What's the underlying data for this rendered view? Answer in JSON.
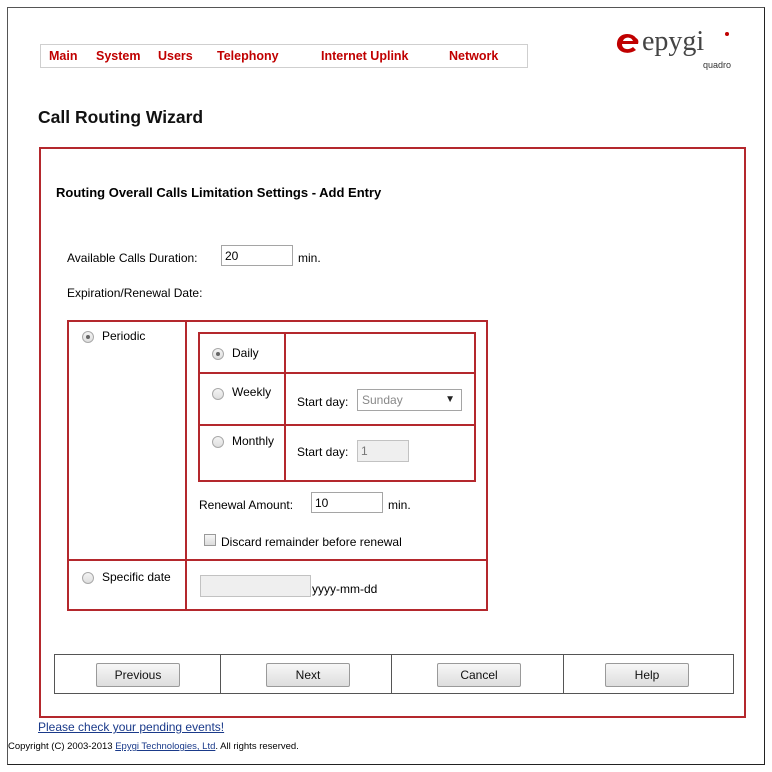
{
  "nav": {
    "items": [
      {
        "label": "Main"
      },
      {
        "label": "System"
      },
      {
        "label": "Users"
      },
      {
        "label": "Telephony"
      },
      {
        "label": "Internet Uplink"
      },
      {
        "label": "Network"
      }
    ]
  },
  "logo": {
    "word": "epygi",
    "sub": "quadro"
  },
  "page_title": "Call Routing Wizard",
  "form": {
    "heading": "Routing Overall Calls Limitation Settings - Add Entry",
    "available_duration_label": "Available Calls Duration:",
    "available_duration_value": "20",
    "available_duration_unit": "min.",
    "expiration_label": "Expiration/Renewal Date:",
    "periodic_label": "Periodic",
    "daily_label": "Daily",
    "weekly_label": "Weekly",
    "weekly_start_label": "Start day:",
    "weekly_start_value": "Sunday",
    "monthly_label": "Monthly",
    "monthly_start_label": "Start day:",
    "monthly_start_value": "1",
    "renewal_label": "Renewal Amount:",
    "renewal_value": "10",
    "renewal_unit": "min.",
    "discard_label": "Discard remainder before renewal",
    "specific_label": "Specific date",
    "specific_value": "",
    "specific_format": "yyyy-mm-dd"
  },
  "buttons": {
    "previous": "Previous",
    "next": "Next",
    "cancel": "Cancel",
    "help": "Help"
  },
  "footer": {
    "pending_link": "Please check your pending events!",
    "copyright_pre": "Copyright (C) 2003-2013 ",
    "copyright_link": "Epygi Technologies, Ltd",
    "copyright_post": ". All rights reserved."
  },
  "colors": {
    "accent": "#b4282d",
    "nav_text": "#c00000",
    "link": "#1a3a8a"
  }
}
